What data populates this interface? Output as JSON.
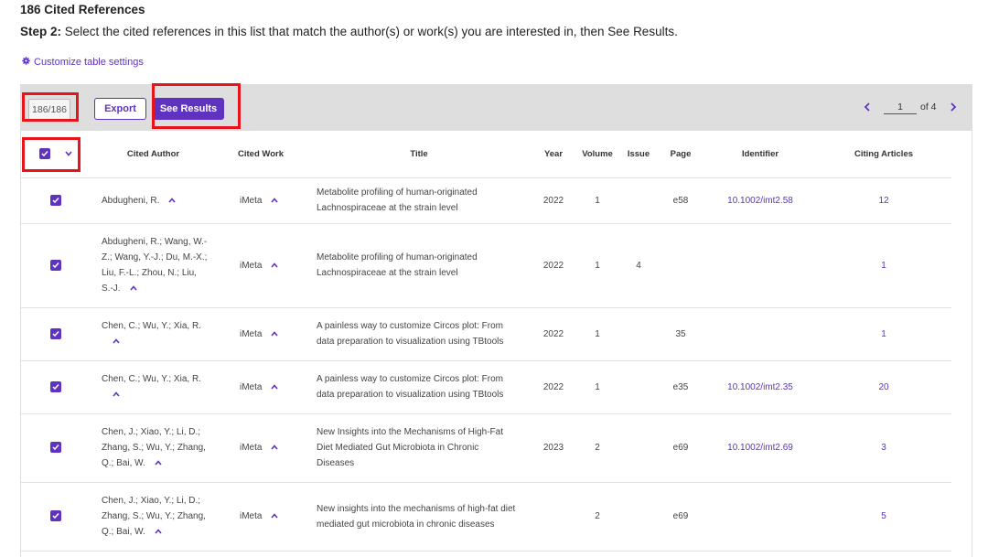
{
  "page": {
    "heading": "186 Cited References",
    "step_label": "Step 2:",
    "step_text": " Select the cited references in this list that match the author(s) or work(s) you are interested in, then See Results.",
    "customize_label": "Customize table settings"
  },
  "toolbar": {
    "count": "186/186",
    "export_label": "Export",
    "see_results_label": "See Results",
    "current_page": "1",
    "total_pages_label": "of 4"
  },
  "colors": {
    "accent": "#5e33bf",
    "highlight": "#e8141b",
    "toolbar_bg": "#dedede"
  },
  "columns": [
    "Cited Author",
    "Cited Work",
    "Title",
    "Year",
    "Volume",
    "Issue",
    "Page",
    "Identifier",
    "Citing Articles"
  ],
  "rows": [
    {
      "author": "Abdugheni, R.",
      "work": "iMeta",
      "title": "Metabolite profiling of human-originated Lachnospiraceae at the strain level",
      "year": "2022",
      "volume": "1",
      "issue": "",
      "page": "e58",
      "identifier": "10.1002/imt2.58",
      "citing": "12"
    },
    {
      "author": "Abdugheni, R.; Wang, W.-Z.; Wang, Y.-J.; Du, M.-X.; Liu, F.-L.; Zhou, N.; Liu, S.-J.",
      "work": "iMeta",
      "title": "Metabolite profiling of human-originated Lachnospiraceae at the strain level",
      "year": "2022",
      "volume": "1",
      "issue": "4",
      "page": "",
      "identifier": "",
      "citing": "1"
    },
    {
      "author": "Chen, C.; Wu, Y.; Xia, R.",
      "work": "iMeta",
      "title": "A painless way to customize Circos plot: From data preparation to visualization using TBtools",
      "year": "2022",
      "volume": "1",
      "issue": "",
      "page": "35",
      "identifier": "",
      "citing": "1"
    },
    {
      "author": "Chen, C.; Wu, Y.; Xia, R.",
      "work": "iMeta",
      "title": "A painless way to customize Circos plot: From data preparation to visualization using TBtools",
      "year": "2022",
      "volume": "1",
      "issue": "",
      "page": "e35",
      "identifier": "10.1002/imt2.35",
      "citing": "20"
    },
    {
      "author": "Chen, J.; Xiao, Y.; Li, D.; Zhang, S.; Wu, Y.; Zhang, Q.; Bai, W.",
      "work": "iMeta",
      "title": "New Insights into the Mechanisms of High-Fat Diet Mediated Gut Microbiota in Chronic Diseases",
      "year": "2023",
      "volume": "2",
      "issue": "",
      "page": "e69",
      "identifier": "10.1002/imt2.69",
      "citing": "3"
    },
    {
      "author": "Chen, J.; Xiao, Y.; Li, D.; Zhang, S.; Wu, Y.; Zhang, Q.; Bai, W.",
      "work": "iMeta",
      "title": "New insights into the mechanisms of high-fat diet mediated gut microbiota in chronic diseases",
      "year": "",
      "volume": "2",
      "issue": "",
      "page": "e69",
      "identifier": "",
      "citing": "5"
    }
  ]
}
